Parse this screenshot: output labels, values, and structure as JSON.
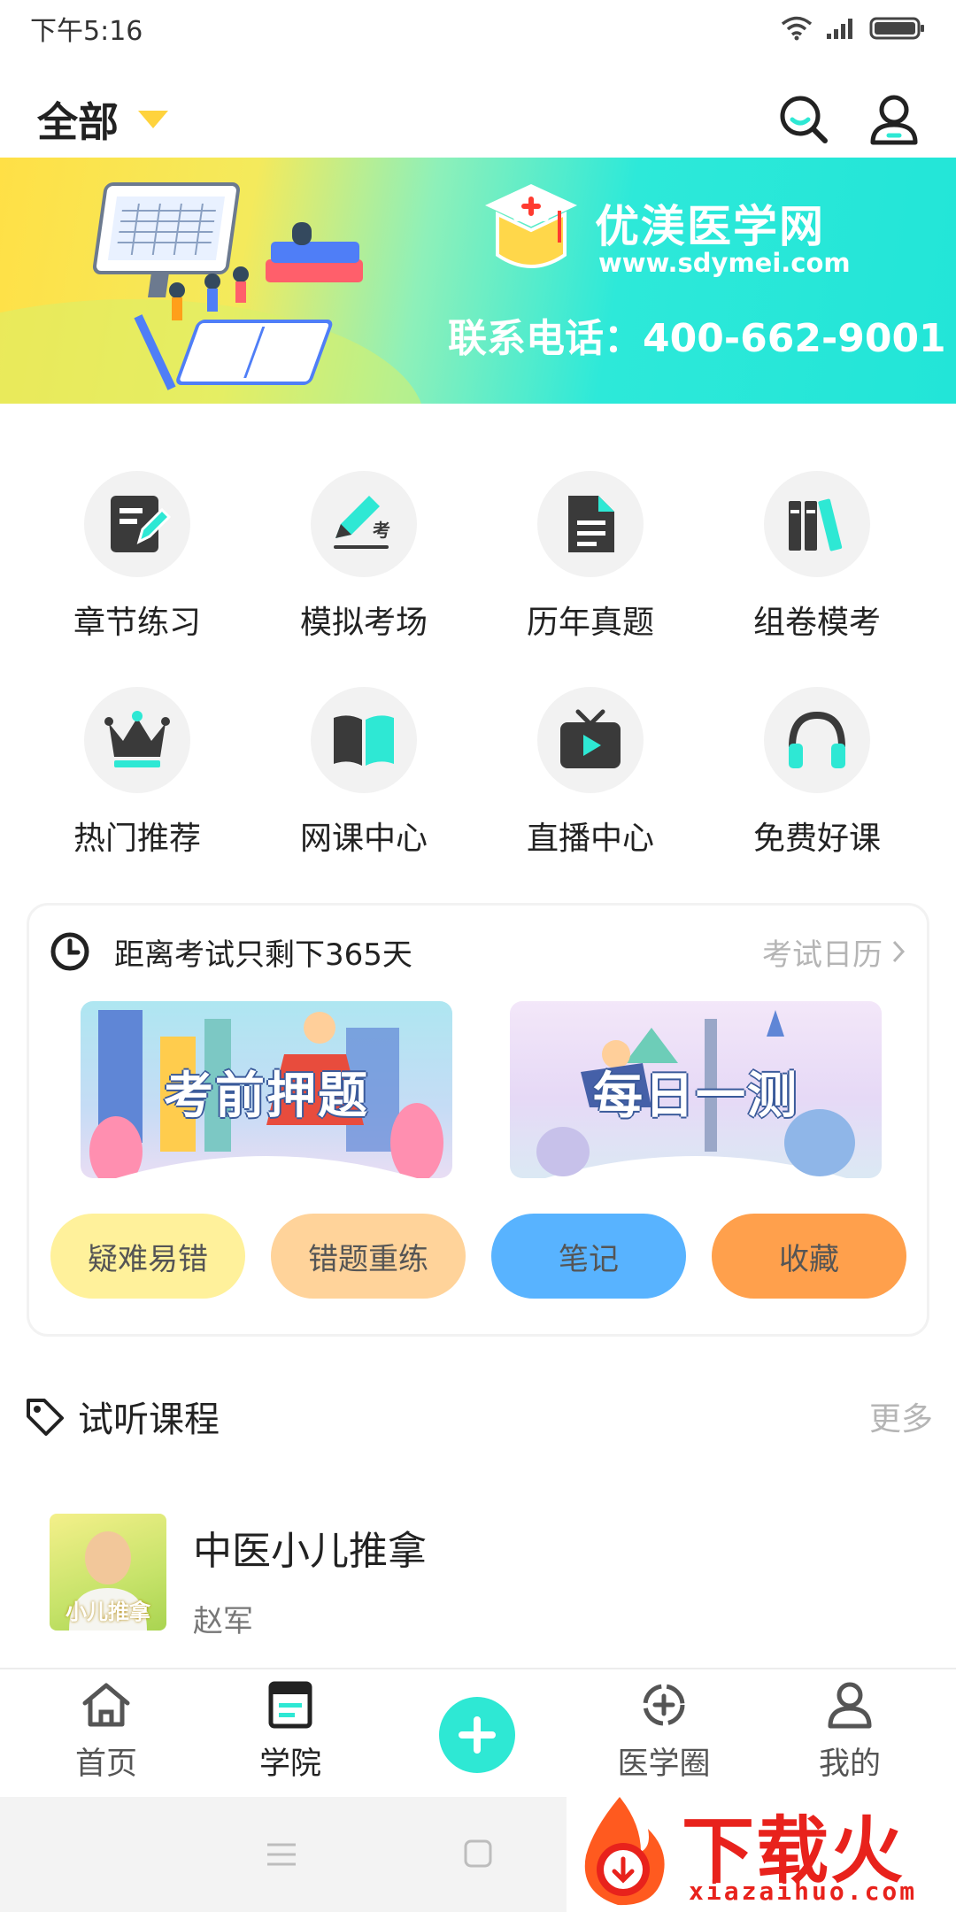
{
  "status_bar": {
    "time": "下午5:16"
  },
  "header": {
    "category": "全部"
  },
  "banner": {
    "brand": "优渼医学网",
    "url": "www.sdymei.com",
    "phone": "联系电话：400-662-9001"
  },
  "features": [
    {
      "label": "章节练习",
      "icon": "notebook-pen-icon"
    },
    {
      "label": "模拟考场",
      "icon": "exam-pen-icon"
    },
    {
      "label": "历年真题",
      "icon": "document-icon"
    },
    {
      "label": "组卷模考",
      "icon": "books-icon"
    },
    {
      "label": "热门推荐",
      "icon": "crown-icon"
    },
    {
      "label": "网课中心",
      "icon": "open-book-icon"
    },
    {
      "label": "直播中心",
      "icon": "tv-play-icon"
    },
    {
      "label": "免费好课",
      "icon": "headphones-icon"
    }
  ],
  "exam": {
    "countdown": "距离考试只剩下365天",
    "calendar_link": "考试日历",
    "promos": [
      "考前押题",
      "每日一测"
    ],
    "pills": [
      {
        "label": "疑难易错",
        "color": "#fff19b"
      },
      {
        "label": "错题重练",
        "color": "#ffd39a"
      },
      {
        "label": "笔记",
        "color": "#58b3ff"
      },
      {
        "label": "收藏",
        "color": "#ffa04c"
      }
    ]
  },
  "trial": {
    "title": "试听课程",
    "more": "更多",
    "course": {
      "title": "中医小儿推拿",
      "teacher": "赵军",
      "thumb_caption": "小儿推拿"
    }
  },
  "nav": {
    "items": [
      {
        "label": "首页",
        "icon": "home-icon"
      },
      {
        "label": "学院",
        "icon": "college-icon"
      },
      {
        "label": "医学圈",
        "icon": "medical-circle-icon"
      },
      {
        "label": "我的",
        "icon": "profile-icon"
      }
    ],
    "active": "学院"
  },
  "watermark": {
    "text": "下载火",
    "url": "xiazaihuo.com"
  },
  "colors": {
    "accent": "#2ee8d4",
    "caret": "#ffd33d",
    "icon_dark": "#3a3a3a"
  }
}
